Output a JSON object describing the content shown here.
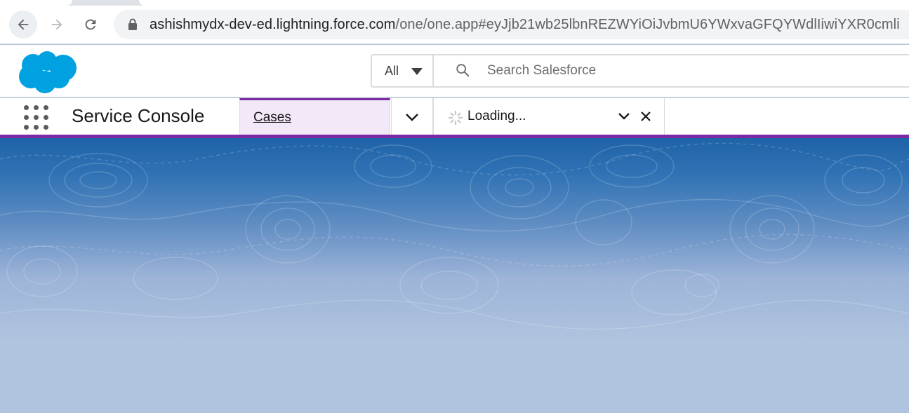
{
  "browser": {
    "url_host": "ashishmydx-dev-ed.lightning.force.com",
    "url_path": "/one/one.app#eyJjb21wb25lbnREZWYiOiJvbmU6YWxvaGFQYWdlIiwiYXR0cmli"
  },
  "header": {
    "search_scope": "All",
    "search_placeholder": "Search Salesforce"
  },
  "console": {
    "app_name": "Service Console",
    "tabs": [
      {
        "label": "Cases",
        "active": true
      },
      {
        "label": "Loading...",
        "active": false
      }
    ]
  },
  "colors": {
    "accent": "#7b2aa6",
    "salesforce_blue": "#00a1e0",
    "active_tab_bg": "#f3e8f7"
  }
}
